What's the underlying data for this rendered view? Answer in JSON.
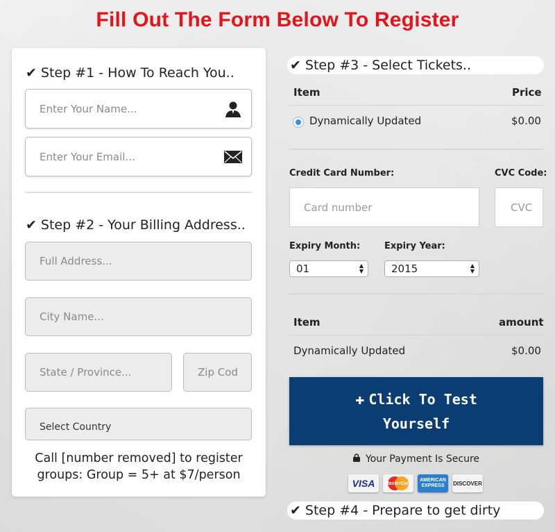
{
  "page": {
    "title": "Fill Out The Form Below To Register"
  },
  "step1": {
    "heading": "Step #1 - How To Reach You..",
    "name_placeholder": "Enter Your Name...",
    "email_placeholder": "Enter Your Email..."
  },
  "step2": {
    "heading": "Step #2 - Your Billing Address..",
    "address_placeholder": "Full Address...",
    "city_placeholder": "City Name...",
    "state_placeholder": "State / Province...",
    "zip_placeholder": "Zip Cod",
    "country_selected": "Select Country"
  },
  "call_text": {
    "line1": "Call [number removed] to register",
    "line2": "groups: Group = 5+ at $7/person"
  },
  "step3": {
    "heading": "Step #3 - Select Tickets..",
    "col_item": "Item",
    "col_price": "Price",
    "ticket_name": "Dynamically Updated",
    "ticket_price": "$0.00",
    "ticket_selected": true
  },
  "payment": {
    "cc_label": "Credit Card Number:",
    "cc_placeholder": "Card number",
    "cvc_label": "CVC Code:",
    "cvc_placeholder": "CVC",
    "month_label": "Expiry Month:",
    "month_value": "01",
    "year_label": "Expiry Year:",
    "year_value": "2015"
  },
  "summary": {
    "col_item": "Item",
    "col_amount": "amount",
    "row_name": "Dynamically Updated",
    "row_amount": "$0.00"
  },
  "cta": {
    "line1": "Click To Test",
    "line2": "Yourself"
  },
  "secure": {
    "text": "Your Payment Is Secure",
    "cards": [
      "VISA",
      "MasterCard",
      "AMERICAN EXPRESS",
      "DISCOVER"
    ]
  },
  "step4": {
    "heading": "Step #4 - Prepare to get dirty"
  },
  "colors": {
    "title_red": "#e5141a",
    "button_blue": "#0a3e72",
    "radio_blue": "#3a8cf0"
  }
}
